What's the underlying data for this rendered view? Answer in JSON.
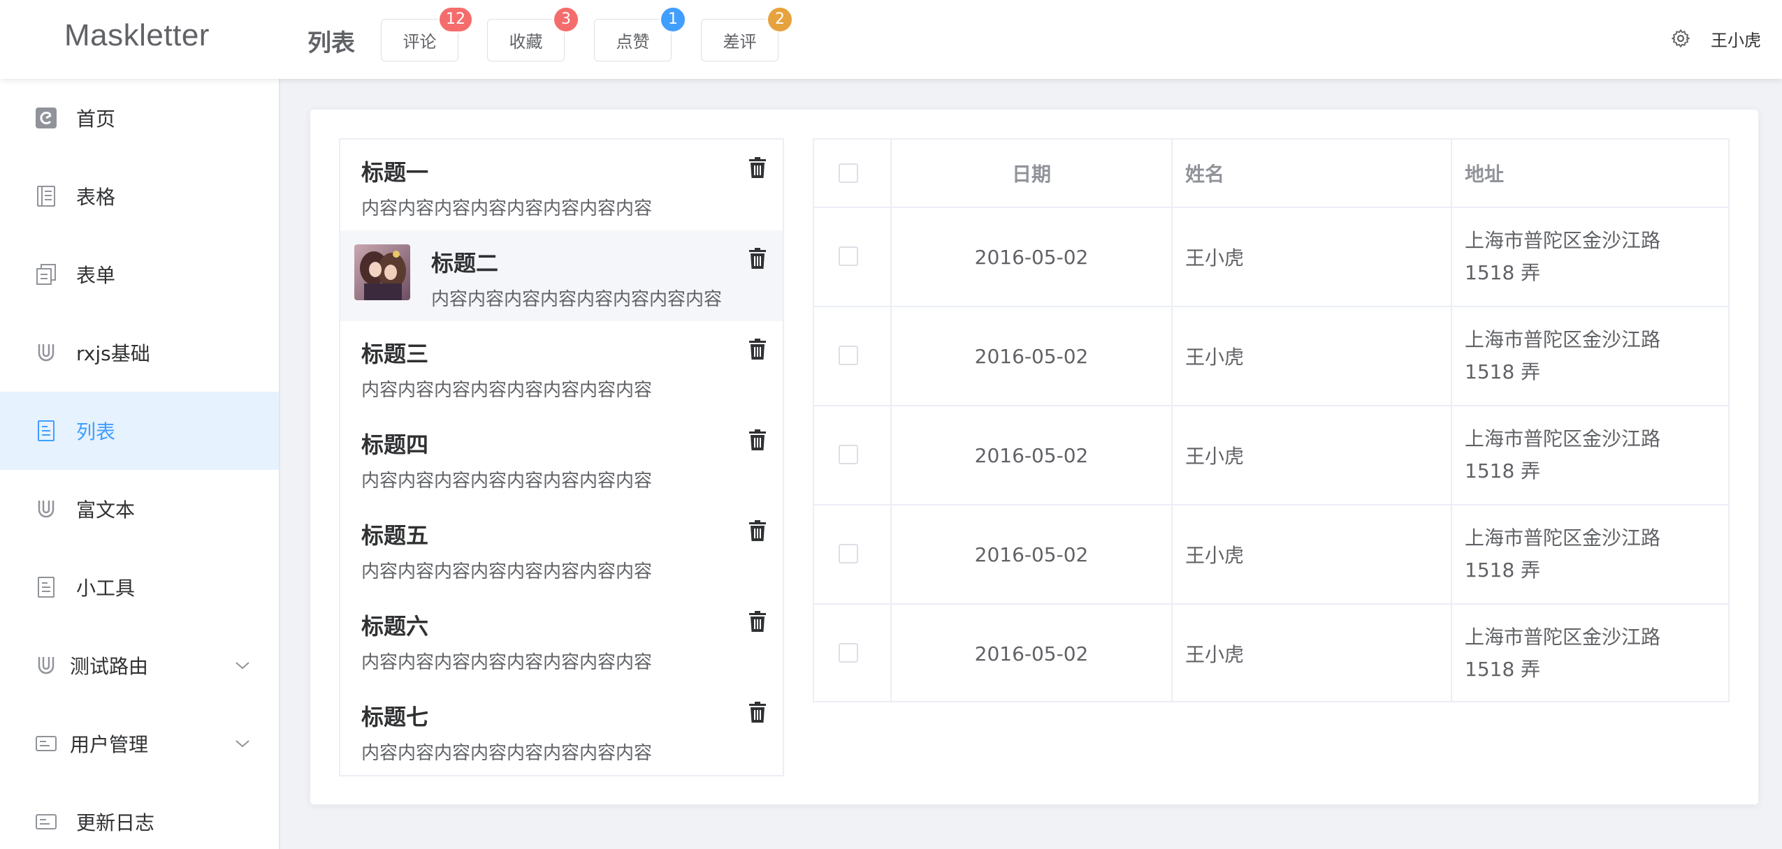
{
  "header": {
    "logo": "Maskletter",
    "page_title": "列表",
    "buttons": [
      {
        "label": "评论",
        "badge": "12",
        "badge_color": "#f56c6c"
      },
      {
        "label": "收藏",
        "badge": "3",
        "badge_color": "#f56c6c"
      },
      {
        "label": "点赞",
        "badge": "1",
        "badge_color": "#409eff"
      },
      {
        "label": "差评",
        "badge": "2",
        "badge_color": "#e6a23c"
      }
    ],
    "settings_icon": "gear-icon",
    "username": "王小虎"
  },
  "sidebar": {
    "items": [
      {
        "label": "首页",
        "icon": "home-icon"
      },
      {
        "label": "表格",
        "icon": "table-icon"
      },
      {
        "label": "表单",
        "icon": "form-icon"
      },
      {
        "label": "rxjs基础",
        "icon": "magnet-icon"
      },
      {
        "label": "列表",
        "icon": "list-icon",
        "active": true
      },
      {
        "label": "富文本",
        "icon": "magnet-icon"
      },
      {
        "label": "小工具",
        "icon": "document-icon"
      },
      {
        "label": "测试路由",
        "icon": "magnet-icon",
        "expandable": true
      },
      {
        "label": "用户管理",
        "icon": "card-icon",
        "expandable": true
      },
      {
        "label": "更新日志",
        "icon": "card-icon"
      }
    ],
    "active_color": "#409eff"
  },
  "list": {
    "items": [
      {
        "title": "标题一",
        "content": "内容内容内容内容内容内容内容内容"
      },
      {
        "title": "标题二",
        "content": "内容内容内容内容内容内容内容内容",
        "has_avatar": true
      },
      {
        "title": "标题三",
        "content": "内容内容内容内容内容内容内容内容"
      },
      {
        "title": "标题四",
        "content": "内容内容内容内容内容内容内容内容"
      },
      {
        "title": "标题五",
        "content": "内容内容内容内容内容内容内容内容"
      },
      {
        "title": "标题六",
        "content": "内容内容内容内容内容内容内容内容"
      },
      {
        "title": "标题七",
        "content": "内容内容内容内容内容内容内容内容"
      }
    ],
    "delete_icon": "trash-icon"
  },
  "table": {
    "columns": [
      "日期",
      "姓名",
      "地址"
    ],
    "rows": [
      {
        "date": "2016-05-02",
        "name": "王小虎",
        "address": "上海市普陀区金沙江路 1518 弄"
      },
      {
        "date": "2016-05-02",
        "name": "王小虎",
        "address": "上海市普陀区金沙江路 1518 弄"
      },
      {
        "date": "2016-05-02",
        "name": "王小虎",
        "address": "上海市普陀区金沙江路 1518 弄"
      },
      {
        "date": "2016-05-02",
        "name": "王小虎",
        "address": "上海市普陀区金沙江路 1518 弄"
      },
      {
        "date": "2016-05-02",
        "name": "王小虎",
        "address": "上海市普陀区金沙江路 1518 弄"
      }
    ]
  }
}
